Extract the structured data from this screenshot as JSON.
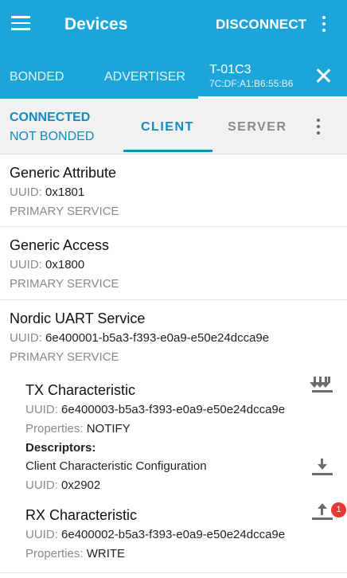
{
  "app_bar": {
    "title": "Devices",
    "disconnect_label": "DISCONNECT"
  },
  "tabs": {
    "bonded": "BONDED",
    "advertiser": "ADVERTISER",
    "device_name": "T-01C3",
    "device_address": "7C:DF:A1:B6:55:B6"
  },
  "status": {
    "connection": "CONNECTED",
    "bond": "NOT BONDED"
  },
  "subtabs": {
    "client": "CLIENT",
    "server": "SERVER"
  },
  "labels": {
    "uuid": "UUID:",
    "primary_service": "PRIMARY SERVICE",
    "properties": "Properties:",
    "descriptors": "Descriptors:"
  },
  "services": [
    {
      "name": "Generic Attribute",
      "uuid": "0x1801"
    },
    {
      "name": "Generic Access",
      "uuid": "0x1800"
    },
    {
      "name": "Nordic UART Service",
      "uuid": "6e400001-b5a3-f393-e0a9-e50e24dcca9e"
    }
  ],
  "characteristics": [
    {
      "name": "TX Characteristic",
      "uuid": "6e400003-b5a3-f393-e0a9-e50e24dcca9e",
      "properties": "NOTIFY",
      "descriptor": {
        "name": "Client Characteristic Configuration",
        "uuid": "0x2902"
      },
      "icon": "notify-multi-download-icon",
      "descriptor_icon": "download-icon"
    },
    {
      "name": "RX Characteristic",
      "uuid": "6e400002-b5a3-f393-e0a9-e50e24dcca9e",
      "properties": "WRITE",
      "icon": "upload-icon",
      "badge": "1"
    }
  ],
  "colors": {
    "primary": "#1ca5d8",
    "accent": "#138bbd",
    "badge": "#e53935"
  }
}
